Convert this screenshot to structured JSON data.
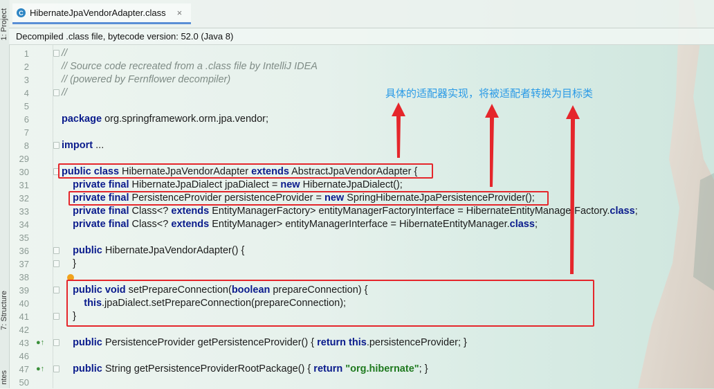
{
  "sidebar": {
    "top_label": "1: Project",
    "bottom_label": "7: Structure",
    "cut_label": "ntes"
  },
  "tab": {
    "icon": "class-file-icon",
    "title": "HibernateJpaVendorAdapter.class",
    "close": "×"
  },
  "infobar": {
    "text": "Decompiled .class file, bytecode version: 52.0 (Java 8)"
  },
  "annotation": {
    "text": "具体的适配器实现，将被适配者转换为目标类",
    "color": "#2a9ae6"
  },
  "colors": {
    "highlight": "#e5262b",
    "keyword": "#0a1b8c",
    "string": "#1f7a1f",
    "comment": "#7f8c86"
  },
  "code": {
    "lines": [
      {
        "n": "1",
        "fold": true,
        "segs": [
          {
            "t": "//",
            "c": "cm"
          }
        ]
      },
      {
        "n": "2",
        "segs": [
          {
            "t": "// Source code recreated from a .class file by IntelliJ IDEA",
            "c": "cm"
          }
        ]
      },
      {
        "n": "3",
        "segs": [
          {
            "t": "// (powered by Fernflower decompiler)",
            "c": "cm"
          }
        ]
      },
      {
        "n": "4",
        "fold": true,
        "segs": [
          {
            "t": "//",
            "c": "cm"
          }
        ]
      },
      {
        "n": "5",
        "segs": []
      },
      {
        "n": "6",
        "segs": [
          {
            "t": "package",
            "c": "kw"
          },
          {
            "t": " org.springframework.orm.jpa.vendor;"
          }
        ]
      },
      {
        "n": "7",
        "segs": []
      },
      {
        "n": "8",
        "fold": true,
        "segs": [
          {
            "t": "import",
            "c": "kw"
          },
          {
            "t": " ..."
          }
        ]
      },
      {
        "n": "29",
        "segs": []
      },
      {
        "n": "30",
        "fold": true,
        "segs": [
          {
            "t": "public class",
            "c": "kw"
          },
          {
            "t": " HibernateJpaVendorAdapter "
          },
          {
            "t": "extends",
            "c": "kw"
          },
          {
            "t": " AbstractJpaVendorAdapter {"
          }
        ]
      },
      {
        "n": "31",
        "segs": [
          {
            "t": "    "
          },
          {
            "t": "private final",
            "c": "kw"
          },
          {
            "t": " HibernateJpaDialect jpaDialect = "
          },
          {
            "t": "new",
            "c": "kw"
          },
          {
            "t": " HibernateJpaDialect();"
          }
        ]
      },
      {
        "n": "32",
        "segs": [
          {
            "t": "    "
          },
          {
            "t": "private final",
            "c": "kw"
          },
          {
            "t": " PersistenceProvider persistenceProvider = "
          },
          {
            "t": "new",
            "c": "kw"
          },
          {
            "t": " SpringHibernateJpaPersistenceProvider();"
          }
        ]
      },
      {
        "n": "33",
        "segs": [
          {
            "t": "    "
          },
          {
            "t": "private final",
            "c": "kw"
          },
          {
            "t": " Class<? "
          },
          {
            "t": "extends",
            "c": "kw"
          },
          {
            "t": " EntityManagerFactory> entityManagerFactoryInterface = HibernateEntityManagerFactory."
          },
          {
            "t": "class",
            "c": "kw"
          },
          {
            "t": ";"
          }
        ]
      },
      {
        "n": "34",
        "segs": [
          {
            "t": "    "
          },
          {
            "t": "private final",
            "c": "kw"
          },
          {
            "t": " Class<? "
          },
          {
            "t": "extends",
            "c": "kw"
          },
          {
            "t": " EntityManager> entityManagerInterface = HibernateEntityManager."
          },
          {
            "t": "class",
            "c": "kw"
          },
          {
            "t": ";"
          }
        ]
      },
      {
        "n": "35",
        "segs": []
      },
      {
        "n": "36",
        "fold": true,
        "segs": [
          {
            "t": "    "
          },
          {
            "t": "public",
            "c": "kw"
          },
          {
            "t": " HibernateJpaVendorAdapter() {"
          }
        ]
      },
      {
        "n": "37",
        "fold": true,
        "segs": [
          {
            "t": "    }"
          }
        ]
      },
      {
        "n": "38",
        "bulb": true,
        "segs": []
      },
      {
        "n": "39",
        "fold": true,
        "segs": [
          {
            "t": "    "
          },
          {
            "t": "public void",
            "c": "kw"
          },
          {
            "t": " setPrepareConnection("
          },
          {
            "t": "boolean",
            "c": "kw"
          },
          {
            "t": " prepareConnection) {"
          }
        ]
      },
      {
        "n": "40",
        "segs": [
          {
            "t": "        "
          },
          {
            "t": "this",
            "c": "kw"
          },
          {
            "t": ".jpaDialect.setPrepareConnection(prepareConnection);"
          }
        ]
      },
      {
        "n": "41",
        "fold": true,
        "segs": [
          {
            "t": "    }"
          }
        ]
      },
      {
        "n": "42",
        "segs": []
      },
      {
        "n": "43",
        "gicon": "●↑",
        "fold": true,
        "segs": [
          {
            "t": "    "
          },
          {
            "t": "public",
            "c": "kw"
          },
          {
            "t": " PersistenceProvider getPersistenceProvider() { "
          },
          {
            "t": "return this",
            "c": "kw"
          },
          {
            "t": ".persistenceProvider; }"
          }
        ]
      },
      {
        "n": "46",
        "segs": []
      },
      {
        "n": "47",
        "gicon": "●↑",
        "fold": true,
        "segs": [
          {
            "t": "    "
          },
          {
            "t": "public",
            "c": "kw"
          },
          {
            "t": " String getPersistenceProviderRootPackage() { "
          },
          {
            "t": "return",
            "c": "kw"
          },
          {
            "t": " "
          },
          {
            "t": "\"org.hibernate\"",
            "c": "st"
          },
          {
            "t": "; }"
          }
        ]
      },
      {
        "n": "50",
        "segs": []
      }
    ]
  }
}
